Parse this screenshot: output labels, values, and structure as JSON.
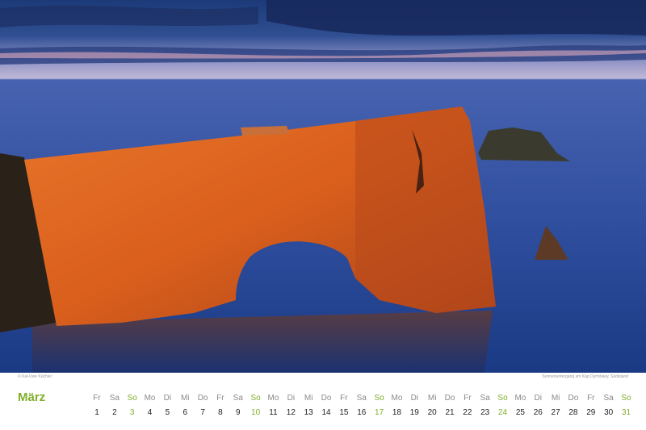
{
  "colors": {
    "accent": "#7fae2a"
  },
  "photo": {
    "subject": "sea-arch-at-sunset-icon"
  },
  "credits": {
    "photographer": "© Kai-Uwe Küchler",
    "caption": "Sonnenuntergang am Kap Dyrhólaey, Südisland"
  },
  "calendar": {
    "month": "März",
    "days": [
      {
        "name": "Fr",
        "num": "1",
        "sunday": false
      },
      {
        "name": "Sa",
        "num": "2",
        "sunday": false
      },
      {
        "name": "So",
        "num": "3",
        "sunday": true
      },
      {
        "name": "Mo",
        "num": "4",
        "sunday": false
      },
      {
        "name": "Di",
        "num": "5",
        "sunday": false
      },
      {
        "name": "Mi",
        "num": "6",
        "sunday": false
      },
      {
        "name": "Do",
        "num": "7",
        "sunday": false
      },
      {
        "name": "Fr",
        "num": "8",
        "sunday": false
      },
      {
        "name": "Sa",
        "num": "9",
        "sunday": false
      },
      {
        "name": "So",
        "num": "10",
        "sunday": true
      },
      {
        "name": "Mo",
        "num": "11",
        "sunday": false
      },
      {
        "name": "Di",
        "num": "12",
        "sunday": false
      },
      {
        "name": "Mi",
        "num": "13",
        "sunday": false
      },
      {
        "name": "Do",
        "num": "14",
        "sunday": false
      },
      {
        "name": "Fr",
        "num": "15",
        "sunday": false
      },
      {
        "name": "Sa",
        "num": "16",
        "sunday": false
      },
      {
        "name": "So",
        "num": "17",
        "sunday": true
      },
      {
        "name": "Mo",
        "num": "18",
        "sunday": false
      },
      {
        "name": "Di",
        "num": "19",
        "sunday": false
      },
      {
        "name": "Mi",
        "num": "20",
        "sunday": false
      },
      {
        "name": "Do",
        "num": "21",
        "sunday": false
      },
      {
        "name": "Fr",
        "num": "22",
        "sunday": false
      },
      {
        "name": "Sa",
        "num": "23",
        "sunday": false
      },
      {
        "name": "So",
        "num": "24",
        "sunday": true
      },
      {
        "name": "Mo",
        "num": "25",
        "sunday": false
      },
      {
        "name": "Di",
        "num": "26",
        "sunday": false
      },
      {
        "name": "Mi",
        "num": "27",
        "sunday": false
      },
      {
        "name": "Do",
        "num": "28",
        "sunday": false
      },
      {
        "name": "Fr",
        "num": "29",
        "sunday": false
      },
      {
        "name": "Sa",
        "num": "30",
        "sunday": false
      },
      {
        "name": "So",
        "num": "31",
        "sunday": true
      }
    ]
  }
}
